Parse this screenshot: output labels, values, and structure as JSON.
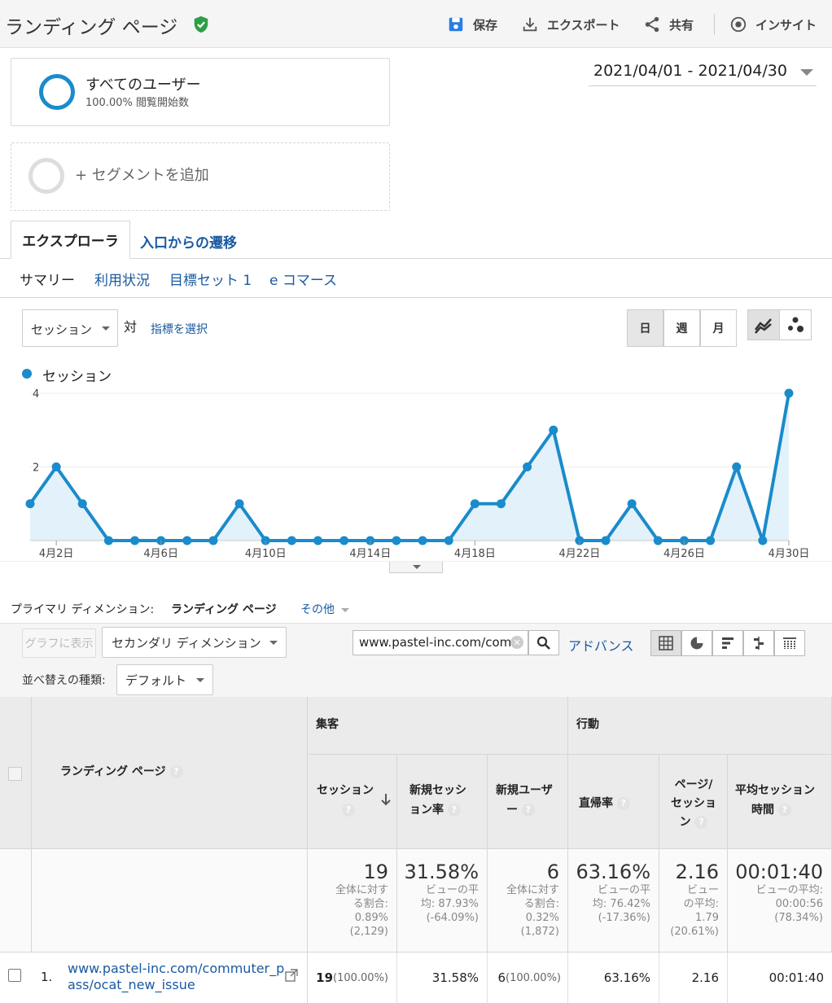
{
  "header": {
    "title": "ランディング ページ",
    "save": "保存",
    "export": "エクスポート",
    "share": "共有",
    "insight": "インサイト"
  },
  "segments": {
    "all_users": "すべてのユーザー",
    "all_users_sub": "100.00% 閲覧開始数",
    "add": "+ セグメントを追加"
  },
  "date_range": "2021/04/01 - 2021/04/30",
  "tabs": {
    "explorer": "エクスプローラ",
    "flow": "入口からの遷移"
  },
  "subtabs": [
    "サマリー",
    "利用状況",
    "目標セット 1",
    "e コマース"
  ],
  "chart_controls": {
    "metric": "セッション",
    "vs": "対",
    "pick_metric": "指標を選択",
    "periods": [
      "日",
      "週",
      "月"
    ]
  },
  "chart_data": {
    "type": "area",
    "series": [
      {
        "name": "セッション",
        "color": "#1a8bcb",
        "values": [
          1,
          2,
          1,
          0,
          0,
          0,
          0,
          0,
          1,
          0,
          0,
          0,
          0,
          0,
          0,
          0,
          0,
          1,
          1,
          2,
          3,
          0,
          0,
          1,
          0,
          0,
          0,
          2,
          0,
          4
        ]
      }
    ],
    "x": [
      "4月1日",
      "4月2日",
      "4月3日",
      "4月4日",
      "4月5日",
      "4月6日",
      "4月7日",
      "4月8日",
      "4月9日",
      "4月10日",
      "4月11日",
      "4月12日",
      "4月13日",
      "4月14日",
      "4月15日",
      "4月16日",
      "4月17日",
      "4月18日",
      "4月19日",
      "4月20日",
      "4月21日",
      "4月22日",
      "4月23日",
      "4月24日",
      "4月25日",
      "4月26日",
      "4月27日",
      "4月28日",
      "4月29日",
      "4月30日"
    ],
    "x_tick_labels": [
      "4月2日",
      "4月6日",
      "4月10日",
      "4月14日",
      "4月18日",
      "4月22日",
      "4月26日",
      "4月30日"
    ],
    "y_tick_labels": [
      "2",
      "4"
    ],
    "ylim": [
      0,
      4
    ],
    "legend": "top-left"
  },
  "primary_dimension": {
    "label": "プライマリ ディメンション:",
    "value": "ランディング ページ",
    "other": "その他"
  },
  "toolbar": {
    "plot": "グラフに表示",
    "secondary_dim": "セカンダリ ディメンション",
    "sort_label": "並べ替えの種類:",
    "sort_value": "デフォルト",
    "search_value": "www.pastel-inc.com/com",
    "advanced": "アドバンス"
  },
  "table": {
    "dimension_header": "ランディング ページ",
    "group_acquisition": "集客",
    "group_behavior": "行動",
    "col_sessions": "セッション",
    "col_new_session_rate_1": "新規セッシ",
    "col_new_session_rate_2": "ョン率",
    "col_new_users_1": "新規ユーザ",
    "col_new_users_2": "ー",
    "col_bounce": "直帰率",
    "col_pages_1": "ページ/",
    "col_pages_2": "セッショ",
    "col_pages_3": "ン",
    "col_duration_1": "平均セッション",
    "col_duration_2": "時間",
    "totals": {
      "sessions": "19",
      "sessions_sub": [
        "全体に対す",
        "る割合:",
        "0.89%",
        "(2,129)"
      ],
      "new_rate": "31.58%",
      "new_rate_sub": [
        "ビューの平",
        "均: 87.93%",
        "(-64.09%)"
      ],
      "new_users": "6",
      "new_users_sub": [
        "全体に対す",
        "る割合:",
        "0.32%",
        "(1,872)"
      ],
      "bounce": "63.16%",
      "bounce_sub": [
        "ビューの平",
        "均: 76.42%",
        "(-17.36%)"
      ],
      "pages": "2.16",
      "pages_sub": [
        "ビュー",
        "の平均:",
        "1.79",
        "(20.61%)"
      ],
      "duration": "00:01:40",
      "duration_sub": [
        "ビューの平均:",
        "00:00:56",
        "(78.34%)"
      ]
    },
    "rows": [
      {
        "index": "1.",
        "page_1": "www.pastel-inc.com/commuter_p",
        "page_2": "ass/ocat_new_issue",
        "sessions": "19",
        "sessions_pct": "(100.00%)",
        "new_rate": "31.58%",
        "new_users": "6",
        "new_users_pct": "(100.00%)",
        "bounce": "63.16%",
        "pages": "2.16",
        "duration": "00:01:40"
      }
    ]
  }
}
